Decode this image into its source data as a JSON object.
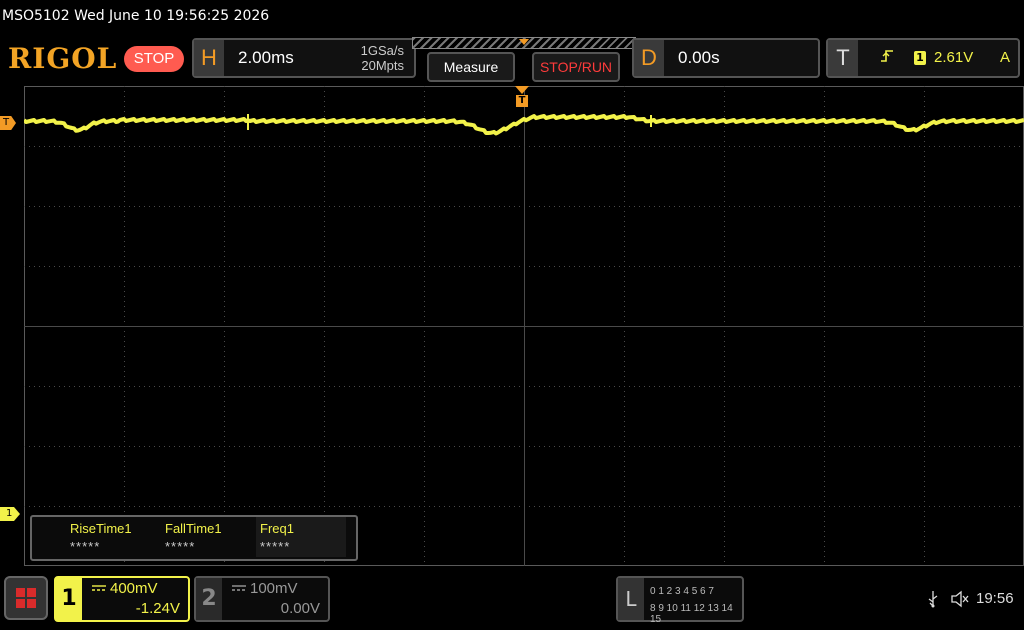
{
  "titlebar": {
    "text": "MSO5102  Wed June 10 19:56:25 2026"
  },
  "topbar": {
    "logo": "RIGOL",
    "run_state": "STOP",
    "horizontal": {
      "letter": "H",
      "timebase": "2.00ms",
      "sample_rate": "1GSa/s",
      "memory_depth": "20Mpts"
    },
    "measure_label": "Measure",
    "stoprun_label": "STOP/RUN",
    "delay": {
      "letter": "D",
      "value": "0.00s"
    },
    "trigger": {
      "letter": "T",
      "source": "1",
      "level": "2.61V",
      "mode": "A"
    }
  },
  "markers": {
    "trigger_level": "T",
    "ch1_ground": "1",
    "trigger_position": "T"
  },
  "measurements": [
    {
      "label": "RiseTime1",
      "value": "*****"
    },
    {
      "label": "FallTime1",
      "value": "*****"
    },
    {
      "label": "Freq1",
      "value": "*****"
    }
  ],
  "channels": {
    "ch1": {
      "number": "1",
      "scale": "400mV",
      "offset": "-1.24V",
      "color": "#f2f24a"
    },
    "ch2": {
      "number": "2",
      "scale": "100mV",
      "offset": "0.00V",
      "color": "#999999"
    }
  },
  "logic": {
    "label": "L",
    "row1": "0 1 2 3   4 5 6 7",
    "row2": "8  9 10 11  12 13 14 15"
  },
  "status": {
    "clock": "19:56"
  },
  "icons": {
    "menu": "menu-grid-icon",
    "usb": "usb-icon",
    "speaker": "speaker-muted-icon",
    "trigger_edge": "rising-edge-icon"
  },
  "colors": {
    "trace": "#f2f24a",
    "accent": "#f39b25",
    "stop": "#ff5b50"
  }
}
